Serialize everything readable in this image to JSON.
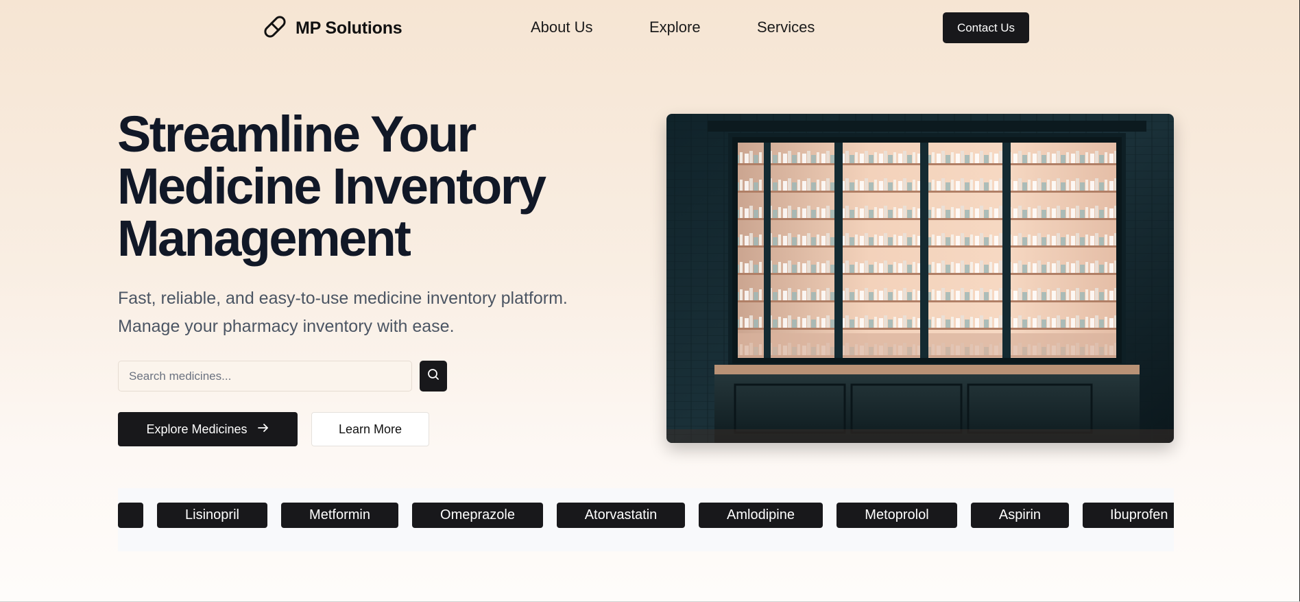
{
  "brand": {
    "name": "MP Solutions",
    "icon": "pill-icon"
  },
  "nav": {
    "items": [
      {
        "label": "About Us"
      },
      {
        "label": "Explore"
      },
      {
        "label": "Services"
      }
    ],
    "contact_label": "Contact Us"
  },
  "hero": {
    "title_lines": [
      "Streamline Your",
      "Medicine Inventory",
      "Management"
    ],
    "subtitle_lines": [
      "Fast, reliable, and easy-to-use medicine inventory platform.",
      "Manage your pharmacy inventory with ease."
    ],
    "search": {
      "placeholder": "Search medicines...",
      "value": "",
      "icon": "search-icon"
    },
    "primary_button": {
      "label": "Explore Medicines",
      "icon": "arrow-right-icon"
    },
    "secondary_button": {
      "label": "Learn More"
    },
    "image": {
      "subject": "pharmacy storefront window with stocked shelves"
    }
  },
  "medicines": {
    "items": [
      "",
      "Lisinopril",
      "Metformin",
      "Omeprazole",
      "Atorvastatin",
      "Amlodipine",
      "Metoprolol",
      "Aspirin",
      "Ibuprofen"
    ]
  },
  "colors": {
    "accent": "#18181b",
    "background_top": "#f6e5d3",
    "title": "#111827",
    "subtitle": "#4b5563"
  }
}
